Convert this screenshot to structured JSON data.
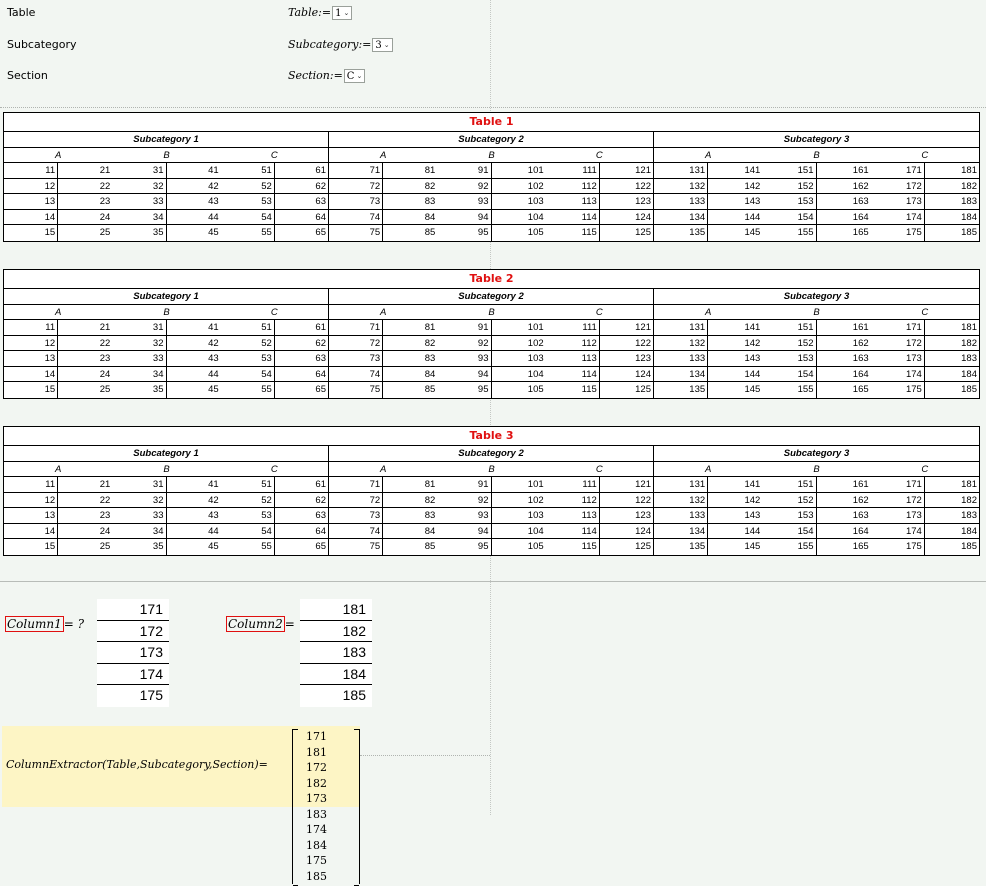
{
  "labels": {
    "table": "Table",
    "subcategory": "Subcategory",
    "section": "Section"
  },
  "definitions": {
    "table": {
      "name": "Table",
      "op": ":=",
      "value": "1"
    },
    "subcategory": {
      "name": "Subcategory",
      "op": ":=",
      "value": "3"
    },
    "section": {
      "name": "Section",
      "op": ":=",
      "value": "C"
    }
  },
  "tables": [
    {
      "title": "Table 1"
    },
    {
      "title": "Table 2"
    },
    {
      "title": "Table 3"
    }
  ],
  "subcategories": [
    "Subcategory 1",
    "Subcategory 2",
    "Subcategory 3"
  ],
  "sections": [
    "A",
    "B",
    "C"
  ],
  "rows": [
    [
      11,
      21,
      31,
      41,
      51,
      61,
      71,
      81,
      91,
      101,
      111,
      121,
      131,
      141,
      151,
      161,
      171,
      181
    ],
    [
      12,
      22,
      32,
      42,
      52,
      62,
      72,
      82,
      92,
      102,
      112,
      122,
      132,
      142,
      152,
      162,
      172,
      182
    ],
    [
      13,
      23,
      33,
      43,
      53,
      63,
      73,
      83,
      93,
      103,
      113,
      123,
      133,
      143,
      153,
      163,
      173,
      183
    ],
    [
      14,
      24,
      34,
      44,
      54,
      64,
      74,
      84,
      94,
      104,
      114,
      124,
      134,
      144,
      154,
      164,
      174,
      184
    ],
    [
      15,
      25,
      35,
      45,
      55,
      65,
      75,
      85,
      95,
      105,
      115,
      125,
      135,
      145,
      155,
      165,
      175,
      185
    ]
  ],
  "column1": {
    "name": "Column1",
    "op": "= ?",
    "values": [
      "171",
      "172",
      "173",
      "174",
      "175"
    ]
  },
  "column2": {
    "name": "Column2",
    "op": "= ?",
    "values": [
      "181",
      "182",
      "183",
      "184",
      "185"
    ]
  },
  "function_call": {
    "expression": "ColumnExtractor(Table,Subcategory,Section)",
    "op": "=",
    "matrix": [
      [
        "171",
        "181"
      ],
      [
        "172",
        "182"
      ],
      [
        "173",
        "183"
      ],
      [
        "174",
        "184"
      ],
      [
        "175",
        "185"
      ]
    ]
  },
  "colors": {
    "accent_red": "#e01010",
    "highlight": "#fdf5c5",
    "background": "#f2f6f2"
  }
}
